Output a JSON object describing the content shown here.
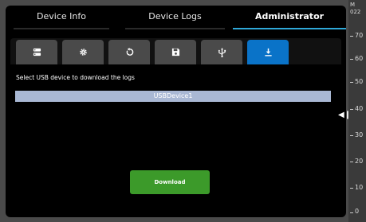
{
  "tabs": [
    {
      "label": "Device Info",
      "active": false
    },
    {
      "label": "Device Logs",
      "active": false
    },
    {
      "label": "Administrator",
      "active": true
    }
  ],
  "toolbar": [
    {
      "icon": "server-icon",
      "active": false
    },
    {
      "icon": "gear-icon",
      "active": false
    },
    {
      "icon": "restore-icon",
      "active": false
    },
    {
      "icon": "save-icon",
      "active": false
    },
    {
      "icon": "usb-icon",
      "active": false
    },
    {
      "icon": "download-icon",
      "active": true
    }
  ],
  "content": {
    "prompt": "Select USB device to download the logs",
    "devices": [
      "USBDevice1"
    ],
    "download_label": "Download"
  },
  "right_strip": {
    "header_line1": "M",
    "header_line2": "022",
    "scale": [
      "70",
      "60",
      "50",
      "40",
      "30",
      "20",
      "10",
      "0"
    ]
  },
  "colors": {
    "accent": "#2fa8d8",
    "toolbar_active": "#0a73c8",
    "button_green": "#3c9a2a",
    "selected_row": "#a9b8d4"
  }
}
